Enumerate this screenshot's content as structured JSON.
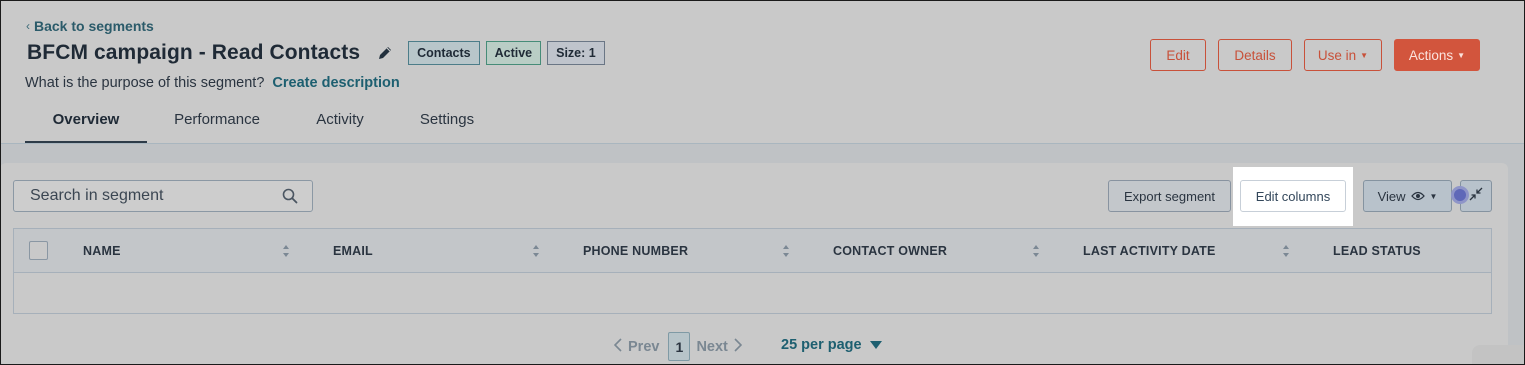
{
  "header": {
    "back_label": "Back to segments",
    "title": "BFCM campaign - Read Contacts",
    "tags": {
      "type": "Contacts",
      "status": "Active",
      "size": "Size: 1"
    },
    "purpose_text": "What is the purpose of this segment?",
    "purpose_link": "Create description",
    "buttons": {
      "edit": "Edit",
      "details": "Details",
      "use_in": "Use in",
      "actions": "Actions"
    }
  },
  "tabs": [
    {
      "label": "Overview",
      "active": true
    },
    {
      "label": "Performance",
      "active": false
    },
    {
      "label": "Activity",
      "active": false
    },
    {
      "label": "Settings",
      "active": false
    }
  ],
  "toolbar": {
    "search_placeholder": "Search in segment",
    "export_label": "Export segment",
    "edit_columns_label": "Edit columns",
    "view_label": "View"
  },
  "table": {
    "columns": [
      "NAME",
      "EMAIL",
      "PHONE NUMBER",
      "CONTACT OWNER",
      "LAST ACTIVITY DATE",
      "LEAD STATUS"
    ],
    "rows": []
  },
  "pagination": {
    "prev_label": "Prev",
    "current_page": "1",
    "next_label": "Next",
    "per_page_label": "25 per page"
  },
  "colors": {
    "accent_orange": "#d2553d",
    "link_teal": "#1d5f70",
    "overlay_bg": "#c9c9c9",
    "highlight": "#ffffff"
  },
  "icons": {
    "back": "chevron-left-icon",
    "title_edit": "pencil-icon",
    "search": "search-icon",
    "view": "eye-icon",
    "collapse": "collapse-arrows-icon",
    "sort": "sort-icon",
    "per_page": "caret-down-icon"
  }
}
